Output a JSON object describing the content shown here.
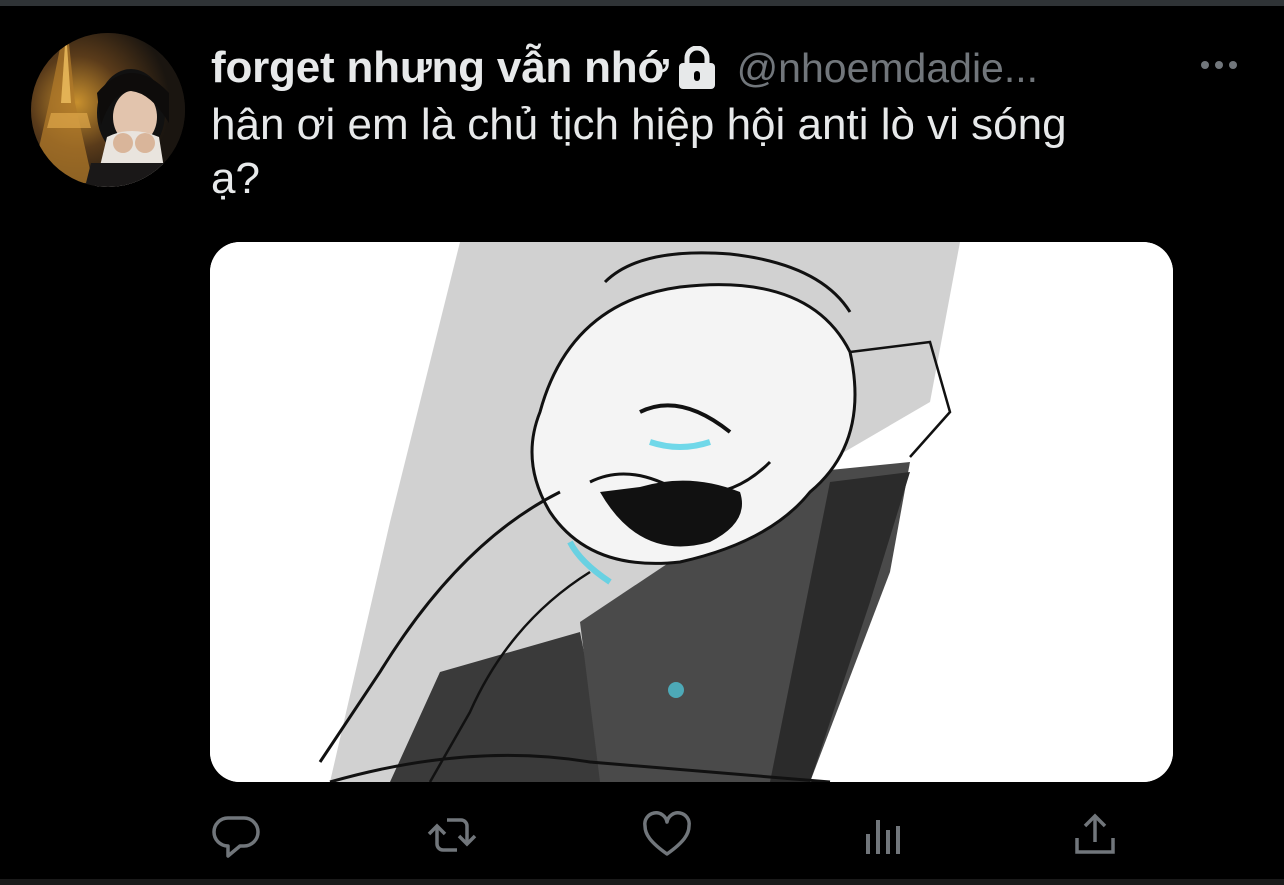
{
  "tweet": {
    "display_name": "forget nhưng vẫn nhớ",
    "handle": "@nhoemdadie...",
    "text": "hân ơi em là chủ tịch hiệp hội anti lò vi sóng\nạ?"
  },
  "icons": {
    "lock": "lock-icon",
    "more": "more-horizontal-icon",
    "reply": "reply-icon",
    "retweet": "retweet-icon",
    "like": "heart-icon",
    "analytics": "analytics-icon",
    "share": "share-icon"
  },
  "colors": {
    "background": "#000000",
    "text": "#e7e9ea",
    "secondary": "#71767b",
    "icon": "#71767b",
    "tear_accent": "#4fd1e6"
  }
}
